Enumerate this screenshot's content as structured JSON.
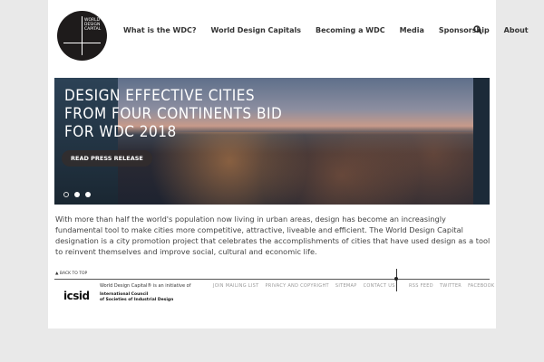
{
  "logo": {
    "lines": [
      "WORLD",
      "DESIGN",
      "CAPITAL"
    ]
  },
  "nav": {
    "items": [
      "What is the WDC?",
      "World Design Capitals",
      "Becoming a WDC",
      "Media",
      "Sponsorship",
      "About"
    ]
  },
  "hero": {
    "headline": "DESIGN EFFECTIVE CITIES FROM FOUR CONTINENTS BID FOR WDC 2018",
    "button": "READ PRESS RELEASE",
    "slides": 3,
    "active_slide": 1
  },
  "intro": "With more than half the world's population now living in urban areas, design has become an increasingly fundamental tool to make cities more competitive, attractive, liveable and efficient. The World Design Capital designation is a city promotion project that celebrates the accomplishments of cities that have used design as a tool to reinvent themselves and improve social, cultural and economic life.",
  "footer": {
    "back_to_top": "BACK TO TOP",
    "initiative": "World Design Capital® is an initiative of",
    "icsid": "icsid",
    "council_line1": "International Council",
    "council_line2": "of Societies of Industrial Design",
    "links": [
      "JOIN MAILING LIST",
      "PRIVACY AND COPYRIGHT",
      "SITEMAP",
      "CONTACT US"
    ],
    "social": [
      "RSS FEED",
      "TWITTER",
      "FACEBOOK"
    ]
  }
}
